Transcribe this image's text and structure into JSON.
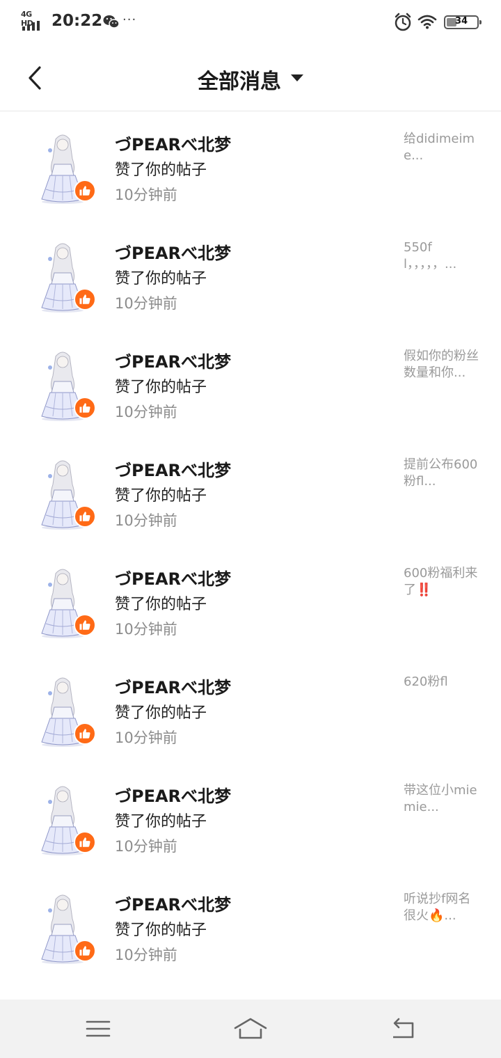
{
  "status_bar": {
    "network": "4G HD",
    "time": "20:22",
    "more": "···",
    "battery": "34",
    "battery_level": 0.34,
    "icons": [
      "signal-icon",
      "wechat-icon",
      "alarm-icon",
      "wifi-icon",
      "battery-icon"
    ]
  },
  "header": {
    "title": "全部消息",
    "back_icon": "chevron-left-icon",
    "dropdown_icon": "caret-down-icon"
  },
  "messages": [
    {
      "name": "づPEARべ北梦",
      "action": "赞了你的帖子",
      "time": "10分钟前",
      "preview": "给didimeime..."
    },
    {
      "name": "づPEARべ北梦",
      "action": "赞了你的帖子",
      "time": "10分钟前",
      "preview": "550fl，，，，，..."
    },
    {
      "name": "づPEARべ北梦",
      "action": "赞了你的帖子",
      "time": "10分钟前",
      "preview": "假如你的粉丝数量和你..."
    },
    {
      "name": "づPEARべ北梦",
      "action": "赞了你的帖子",
      "time": "10分钟前",
      "preview": "提前公布600粉fl..."
    },
    {
      "name": "づPEARべ北梦",
      "action": "赞了你的帖子",
      "time": "10分钟前",
      "preview": "600粉福利来了‼️"
    },
    {
      "name": "づPEARべ北梦",
      "action": "赞了你的帖子",
      "time": "10分钟前",
      "preview": "620粉fl"
    },
    {
      "name": "づPEARべ北梦",
      "action": "赞了你的帖子",
      "time": "10分钟前",
      "preview": "带这位小miemie..."
    },
    {
      "name": "づPEARべ北梦",
      "action": "赞了你的帖子",
      "time": "10分钟前",
      "preview": "听说抄f网名很火🔥..."
    }
  ],
  "colors": {
    "like_badge": "#ff6a16",
    "nav_bar_bg": "#f2f2f2",
    "muted_text": "#8c8c8c"
  },
  "nav_bar": {
    "icons": [
      "menu-icon",
      "home-icon",
      "back-icon"
    ]
  }
}
